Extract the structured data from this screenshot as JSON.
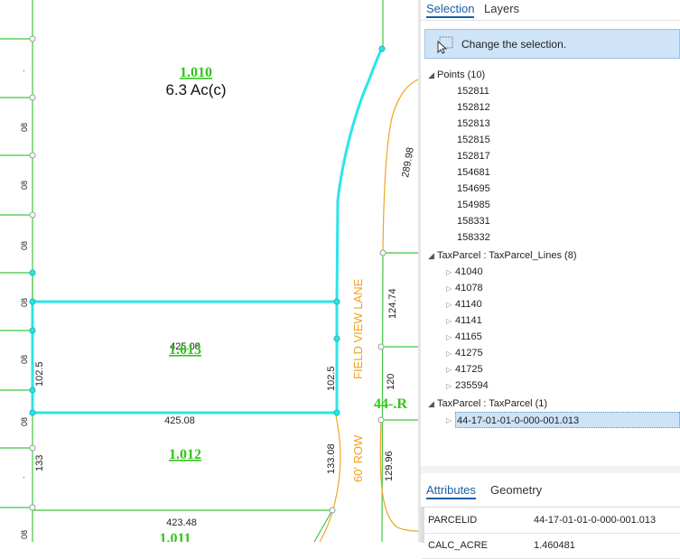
{
  "map": {
    "parcels": [
      {
        "id": "1.010",
        "area": "6.3 Ac(c)"
      },
      {
        "id": "1.013",
        "overlap": "425.08"
      },
      {
        "id": "1.012"
      },
      {
        "id": "1.011"
      }
    ],
    "road_name": "FIELD VIEW LANE",
    "row_label": "60' ROW",
    "partial_label": "44-.R",
    "dims": {
      "d_289_98": "289.98",
      "d_124_74": "124.74",
      "d_120": "120",
      "d_129_96": "129.96",
      "d_102_5_left": "102.5",
      "d_102_5_right": "102.5",
      "d_425_08": "425.08",
      "d_133_08": "133.08",
      "d_133": "133",
      "d_423_48": "423.48",
      "edge_08": "08",
      "edge_dot": "."
    }
  },
  "panel": {
    "tabs": [
      "Selection",
      "Layers"
    ],
    "change_selection": "Change the selection.",
    "groups": [
      {
        "label": "Points (10)",
        "items": [
          "152811",
          "152812",
          "152813",
          "152815",
          "152817",
          "154681",
          "154695",
          "154985",
          "158331",
          "158332"
        ]
      },
      {
        "label": "TaxParcel : TaxParcel_Lines (8)",
        "items": [
          "41040",
          "41078",
          "41140",
          "41141",
          "41165",
          "41275",
          "41725",
          "235594"
        ]
      },
      {
        "label": "TaxParcel : TaxParcel (1)",
        "items": [
          "44-17-01-01-0-000-001.013"
        ]
      }
    ],
    "attr_tabs": [
      "Attributes",
      "Geometry"
    ],
    "attributes": [
      {
        "field": "PARCELID",
        "value": "44-17-01-01-0-000-001.013"
      },
      {
        "field": "CALC_ACRE",
        "value": "1.460481"
      }
    ]
  },
  "colors": {
    "parcel_line": "#44c944",
    "selection": "#33e2e8",
    "label_green": "#33c51a",
    "road_label": "#f0a020",
    "accent": "#1a5fa6"
  }
}
